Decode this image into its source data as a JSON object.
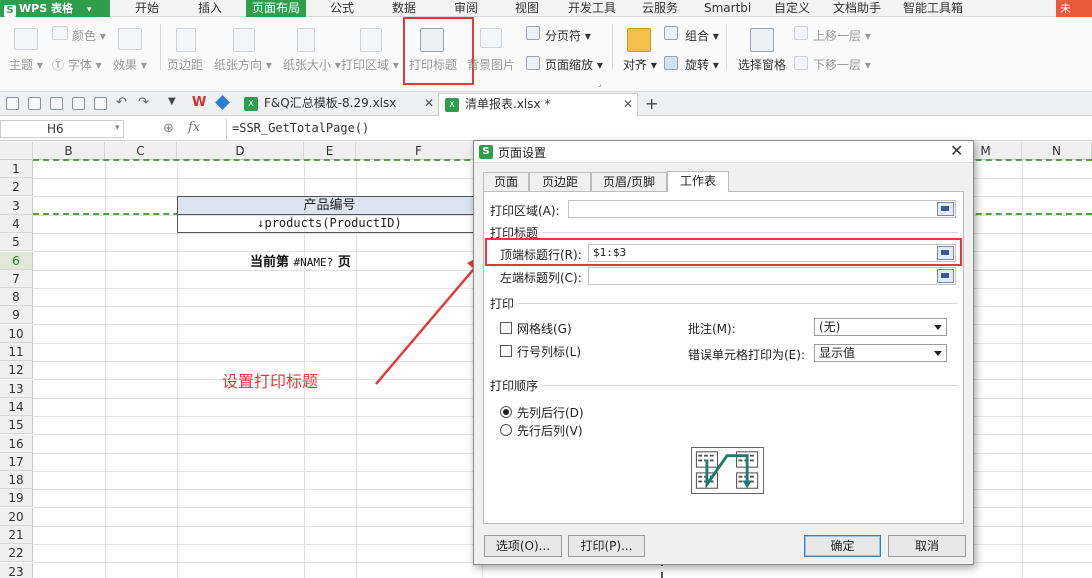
{
  "app": {
    "logo_text": "WPS 表格"
  },
  "menu": {
    "items": [
      "开始",
      "插入",
      "页面布局",
      "公式",
      "数据",
      "审阅",
      "视图",
      "开发工具",
      "云服务",
      "Smartbi",
      "自定义",
      "文档助手",
      "智能工具箱"
    ],
    "active": "页面布局",
    "overflow": "未"
  },
  "ribbon": {
    "theme": "主题",
    "color": "颜色",
    "font": "字体",
    "effect": "效果",
    "margins": "页边距",
    "orientation": "纸张方向",
    "size": "纸张大小",
    "print_area": "打印区域",
    "print_titles": "打印标题",
    "background": "背景图片",
    "page_break": "分页符",
    "page_scale": "页面缩放",
    "align": "对齐",
    "group": "组合",
    "rotate": "旋转",
    "selection_pane": "选择窗格",
    "bring_forward": "上移一层",
    "send_backward": "下移一层"
  },
  "tabs": [
    {
      "name": "F&Q汇总模板-8.29.xlsx"
    },
    {
      "name": "清单报表.xlsx *"
    }
  ],
  "formula_bar": {
    "cell_ref": "H6",
    "fx": "fx",
    "formula": "=SSR_GetTotalPage()"
  },
  "grid": {
    "columns": [
      "B",
      "C",
      "D",
      "E",
      "F",
      "M",
      "N"
    ],
    "rows": [
      "1",
      "2",
      "3",
      "4",
      "5",
      "6",
      "7",
      "8",
      "9",
      "10",
      "11",
      "12",
      "13",
      "14",
      "15",
      "16",
      "17",
      "18",
      "19",
      "20",
      "21",
      "22",
      "23"
    ],
    "selected_row": "6"
  },
  "sheet": {
    "header_cell": "产品编号",
    "products_cell": "products(ProductID)",
    "page_prefix": "当前第",
    "page_error": "#NAME?",
    "page_suffix": "页"
  },
  "annotation": {
    "text": "设置打印标题",
    "color": "#e53935"
  },
  "dialog": {
    "title": "页面设置",
    "tabs": [
      "页面",
      "页边距",
      "页眉/页脚",
      "工作表"
    ],
    "active_tab": "工作表",
    "print_area_label": "打印区域(A):",
    "print_area_value": "",
    "print_titles_group": "打印标题",
    "top_rows_label": "顶端标题行(R):",
    "top_rows_value": "$1:$3",
    "left_cols_label": "左端标题列(C):",
    "left_cols_value": "",
    "print_group": "打印",
    "gridlines_label": "网格线(G)",
    "headings_label": "行号列标(L)",
    "comments_label": "批注(M):",
    "comments_value": "(无)",
    "errors_label": "错误单元格打印为(E):",
    "errors_value": "显示值",
    "order_group": "打印顺序",
    "order_down_then_over": "先列后行(D)",
    "order_over_then_down": "先行后列(V)",
    "selected_order": "先列后行(D)",
    "options_button": "选项(O)...",
    "print_button": "打印(P)...",
    "ok_button": "确定",
    "cancel_button": "取消"
  },
  "colors": {
    "brand": "#2e9e4d",
    "highlight": "#e53935",
    "header_fill": "#dce3f1"
  }
}
